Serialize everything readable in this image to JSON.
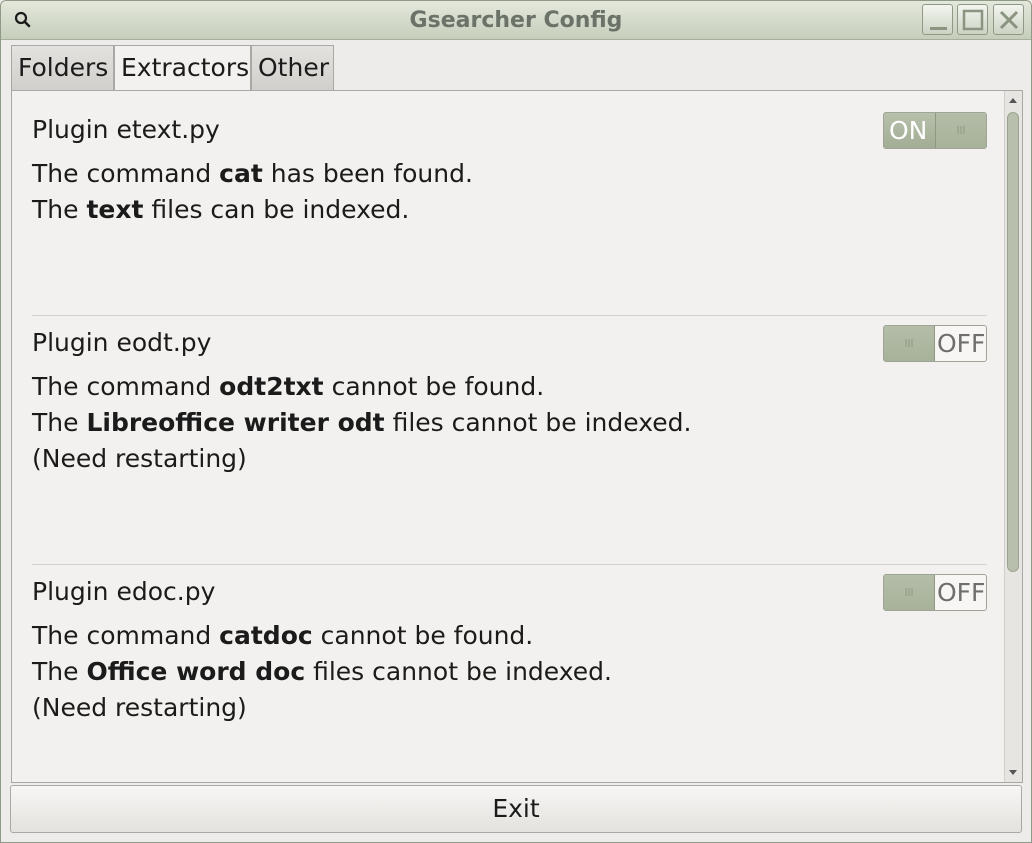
{
  "window": {
    "title": "Gsearcher Config",
    "controls": [
      "minimize-icon",
      "maximize-icon",
      "close-icon"
    ]
  },
  "tabs": [
    {
      "label": "Folders",
      "active": false
    },
    {
      "label": "Extractors",
      "active": true
    },
    {
      "label": "Other",
      "active": false
    }
  ],
  "plugins": [
    {
      "name": "Plugin etext.py",
      "switch": "ON",
      "lines": [
        {
          "pre": "The command ",
          "bold": "cat",
          "post": " has been found."
        },
        {
          "pre": "The ",
          "bold": "text",
          "post": " files can be indexed."
        }
      ],
      "note": ""
    },
    {
      "name": "Plugin eodt.py",
      "switch": "OFF",
      "lines": [
        {
          "pre": "The command ",
          "bold": "odt2txt",
          "post": " cannot be found."
        },
        {
          "pre": "The ",
          "bold": "Libreoffice writer odt",
          "post": " files cannot be indexed."
        }
      ],
      "note": "(Need restarting)"
    },
    {
      "name": "Plugin edoc.py",
      "switch": "OFF",
      "lines": [
        {
          "pre": "The command ",
          "bold": "catdoc",
          "post": " cannot be found."
        },
        {
          "pre": "The ",
          "bold": "Office word doc",
          "post": " files cannot be indexed."
        }
      ],
      "note": "(Need restarting)"
    }
  ],
  "exit_label": "Exit",
  "colors": {
    "titlebar": "#c6cebb",
    "switch_on": "#a3ad95",
    "background": "#f2f1ef"
  }
}
